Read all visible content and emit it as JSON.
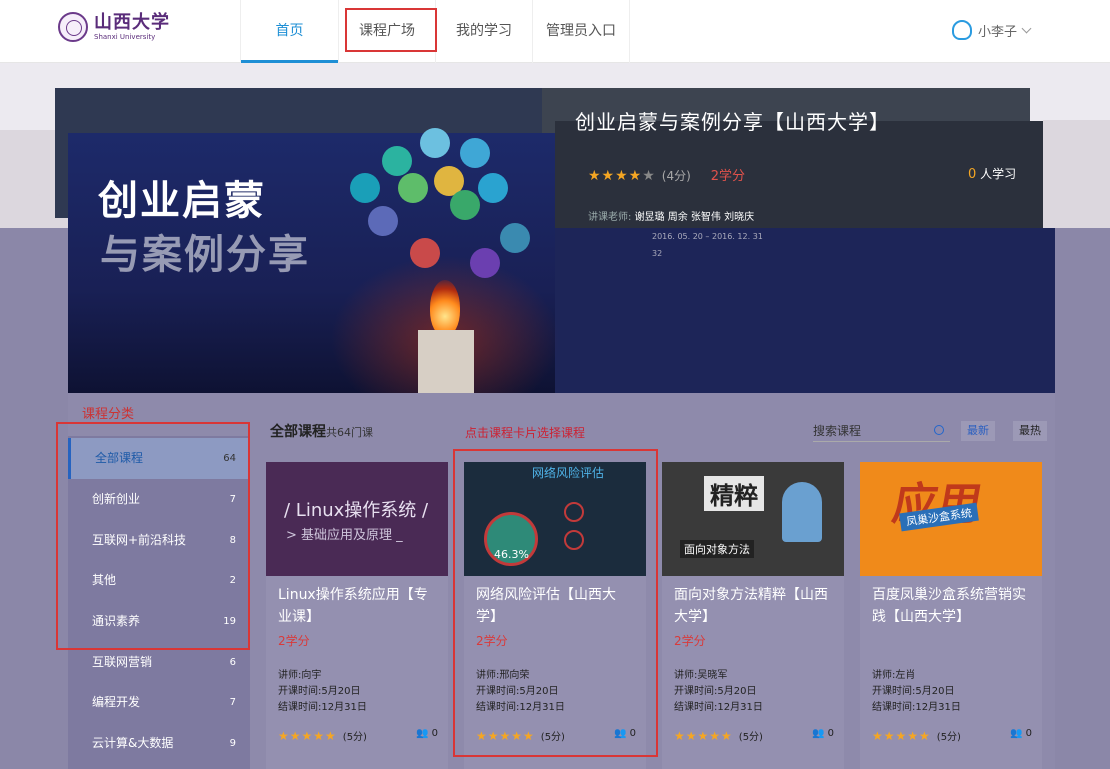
{
  "header": {
    "logo_cn": "山西大学",
    "logo_en": "Shanxi University",
    "nav": [
      "首页",
      "课程广场",
      "我的学习",
      "管理员入口"
    ],
    "user_name": "小李子"
  },
  "banner": {
    "image_title_line1": "创业启蒙",
    "image_title_line2": "与案例分享",
    "course_title": "创业启蒙与案例分享【山西大学】",
    "stars": "★★★★",
    "star_off": "★",
    "score": "(4分)",
    "credit": "2学分",
    "learners_count": "0",
    "learners_suffix": "人学习",
    "teacher_label": "讲课老师:",
    "teachers": "谢昱璐  周余  张智伟  刘晓庆",
    "date_range": "2016. 05. 20 – 2016. 12. 31",
    "extra": "32"
  },
  "sidebar": {
    "title": "课程分类",
    "items": [
      {
        "label": "全部课程",
        "count": "64"
      },
      {
        "label": "创新创业",
        "count": "7"
      },
      {
        "label": "互联网+前沿科技",
        "count": "8"
      },
      {
        "label": "其他",
        "count": "2"
      },
      {
        "label": "通识素养",
        "count": "19"
      },
      {
        "label": "互联网营销",
        "count": "6"
      },
      {
        "label": "编程开发",
        "count": "7"
      },
      {
        "label": "云计算&大数据",
        "count": "9"
      }
    ]
  },
  "content": {
    "heading": "全部课程",
    "total": "共64门课",
    "hint": "点击课程卡片选择课程",
    "search_placeholder": "搜索课程",
    "sort_new": "最新",
    "sort_hot": "最热"
  },
  "cards": [
    {
      "thumb_line1": "/ Linux操作系统 /",
      "thumb_line2": "> 基础应用及原理 _",
      "title": "Linux操作系统应用【专业课】",
      "credit": "2学分",
      "teacher": "讲师:向宇",
      "start": "开课时间:5月20日",
      "end": "结课时间:12月31日",
      "stars": "★★★★★",
      "score": "(5分)",
      "count": "0"
    },
    {
      "thumb_line1": "网络风险评估",
      "thumb_line2": "46.3%",
      "title": "网络风险评估【山西大学】",
      "credit": "2学分",
      "teacher": "讲师:邢向荣",
      "start": "开课时间:5月20日",
      "end": "结课时间:12月31日",
      "stars": "★★★★★",
      "score": "(5分)",
      "count": "0"
    },
    {
      "thumb_line1": "精粹",
      "thumb_line2": "面向对象方法",
      "title": "面向对象方法精粹【山西大学】",
      "credit": "2学分",
      "teacher": "讲师:吴晓军",
      "start": "开课时间:5月20日",
      "end": "结课时间:12月31日",
      "stars": "★★★★★",
      "score": "(5分)",
      "count": "0"
    },
    {
      "thumb_line1": "应用",
      "thumb_line2": "凤巢沙盒系统",
      "title": "百度凤巢沙盒系统营销实践【山西大学】",
      "credit": "",
      "teacher": "讲师:左肖",
      "start": "开课时间:5月20日",
      "end": "结课时间:12月31日",
      "stars": "★★★★★",
      "score": "(5分)",
      "count": "0"
    }
  ]
}
